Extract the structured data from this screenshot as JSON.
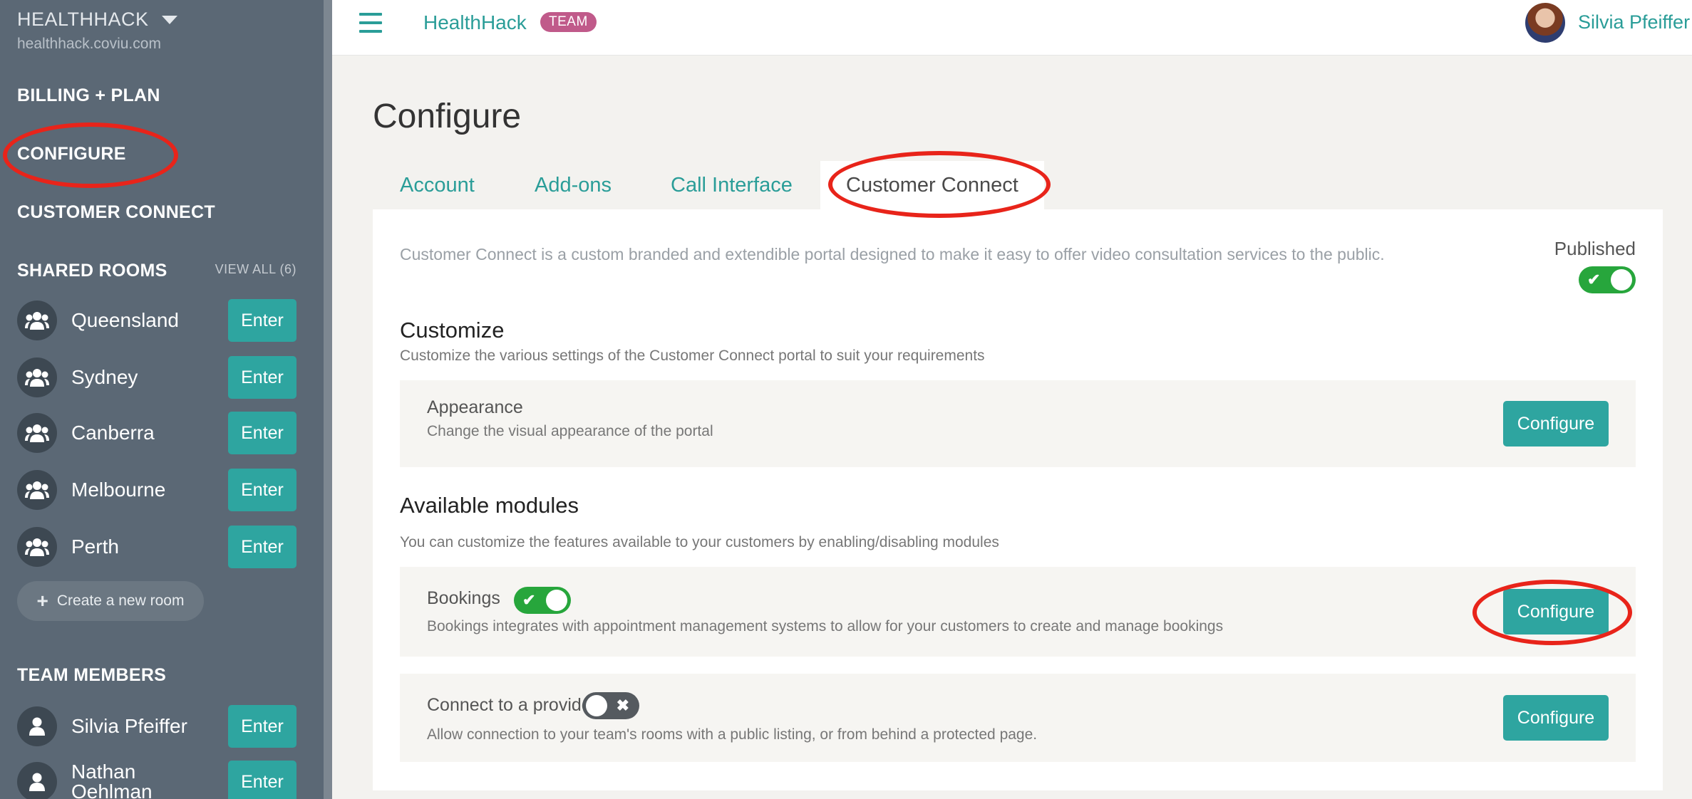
{
  "sidebar": {
    "team_name": "HEALTHHACK",
    "team_url": "healthhack.coviu.com",
    "nav": {
      "billing": "BILLING + PLAN",
      "configure": "CONFIGURE",
      "customer_connect": "CUSTOMER CONNECT"
    },
    "shared_rooms": {
      "heading": "SHARED ROOMS",
      "view_all": "VIEW ALL (6)",
      "rooms": [
        {
          "name": "Queensland",
          "action": "Enter"
        },
        {
          "name": "Sydney",
          "action": "Enter"
        },
        {
          "name": "Canberra",
          "action": "Enter"
        },
        {
          "name": "Melbourne",
          "action": "Enter"
        },
        {
          "name": "Perth",
          "action": "Enter"
        }
      ],
      "create_label": "Create a new room"
    },
    "team_members": {
      "heading": "TEAM MEMBERS",
      "members": [
        {
          "name": "Silvia Pfeiffer",
          "action": "Enter"
        },
        {
          "name": "Nathan Oehlman",
          "action": "Enter"
        }
      ]
    }
  },
  "topbar": {
    "brand": "HealthHack",
    "badge": "TEAM",
    "user_name": "Silvia Pfeiffer"
  },
  "main": {
    "title": "Configure",
    "tabs": [
      {
        "label": "Account"
      },
      {
        "label": "Add-ons"
      },
      {
        "label": "Call Interface"
      },
      {
        "label": "Customer Connect",
        "active": true
      }
    ],
    "intro": "Customer Connect is a custom branded and extendible portal designed to make it easy to offer video consultation services to the public.",
    "published": {
      "label": "Published",
      "on": true
    },
    "customize": {
      "heading": "Customize",
      "sub": "Customize the various settings of the Customer Connect portal to suit your requirements",
      "appearance": {
        "title": "Appearance",
        "desc": "Change the visual appearance of the portal",
        "button": "Configure"
      }
    },
    "modules": {
      "heading": "Available modules",
      "sub": "You can customize the features available to your customers by enabling/disabling modules",
      "items": [
        {
          "title": "Bookings",
          "enabled": true,
          "desc": "Bookings integrates with appointment management systems to allow for your customers to create and manage bookings",
          "button": "Configure"
        },
        {
          "title": "Connect to a provider",
          "enabled": false,
          "desc": "Allow connection to your team's rooms with a public listing, or from behind a protected page.",
          "button": "Configure"
        }
      ]
    }
  },
  "icons": {
    "menu": "hamburger-icon",
    "group": "group-icon",
    "person": "person-icon",
    "check": "check-icon",
    "close": "x-icon",
    "caret": "caret-down-icon",
    "plus": "plus-icon"
  },
  "colors": {
    "accent": "#2ea5a0",
    "sidebar": "#5b6875",
    "badge": "#c05a8a",
    "toggle_on": "#27a63c",
    "toggle_off": "#555a5f",
    "annotation": "#e8241a"
  }
}
